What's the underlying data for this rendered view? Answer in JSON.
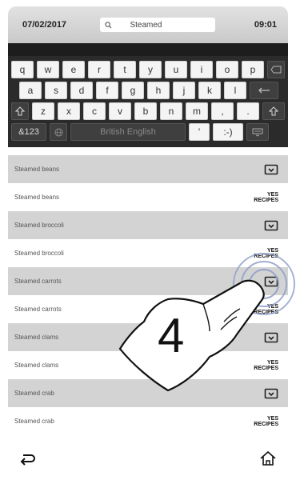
{
  "status_bar": {
    "date": "07/02/2017",
    "time": "09:01"
  },
  "search": {
    "value": "Steamed"
  },
  "keyboard": {
    "row1": [
      "q",
      "w",
      "e",
      "r",
      "t",
      "y",
      "u",
      "i",
      "o",
      "p"
    ],
    "row2": [
      "a",
      "s",
      "d",
      "f",
      "g",
      "h",
      "j",
      "k",
      "l"
    ],
    "row3": [
      "z",
      "x",
      "c",
      "v",
      "b",
      "n",
      "m",
      ",",
      "."
    ],
    "symbols_label": "&123",
    "space_label": "British English",
    "apostrophe": "'",
    "emoticon": ":-)"
  },
  "list": {
    "items": [
      {
        "label": "Steamed beans",
        "style": "grey",
        "icon": "tray-icon"
      },
      {
        "label": "Steamed beans",
        "style": "white",
        "icon": "yes-recipes-logo"
      },
      {
        "label": "Steamed broccoli",
        "style": "grey",
        "icon": "tray-icon"
      },
      {
        "label": "Steamed broccoli",
        "style": "white",
        "icon": "yes-recipes-logo"
      },
      {
        "label": "Steamed carrots",
        "style": "grey",
        "icon": "tray-icon"
      },
      {
        "label": "Steamed carrots",
        "style": "white",
        "icon": "yes-recipes-logo"
      },
      {
        "label": "Steamed clams",
        "style": "grey",
        "icon": "tray-icon"
      },
      {
        "label": "Steamed clams",
        "style": "white",
        "icon": "yes-recipes-logo"
      },
      {
        "label": "Steamed crab",
        "style": "grey",
        "icon": "tray-icon"
      },
      {
        "label": "Steamed crab",
        "style": "white",
        "icon": "yes-recipes-logo"
      }
    ],
    "logo_text_line1": "YES",
    "logo_text_line2": "RECIPES"
  },
  "annotation": {
    "step_number": "4"
  },
  "colors": {
    "grey_row": "#d3d3d3",
    "keyboard_bg": "#2b2b2b",
    "status_bg": "#d0d0d0"
  }
}
